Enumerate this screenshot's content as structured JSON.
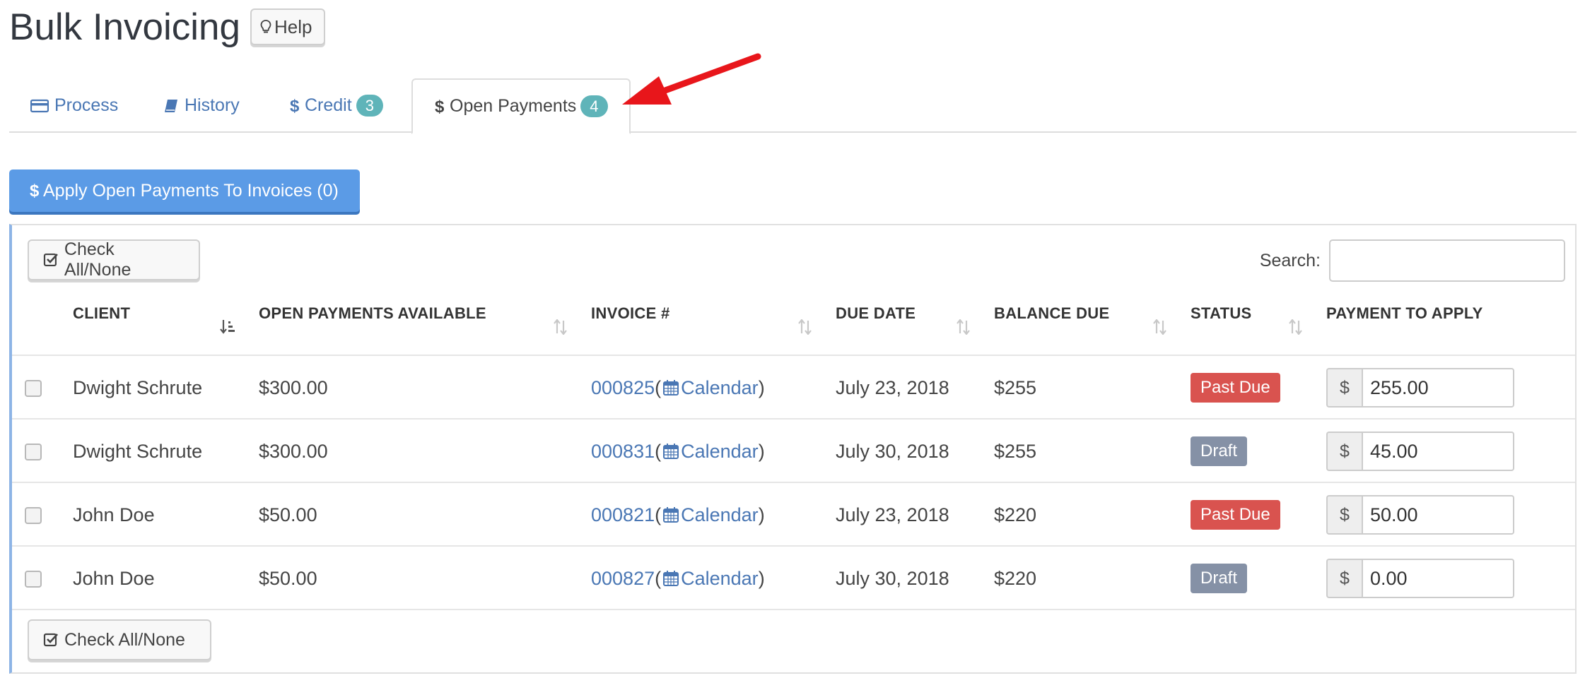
{
  "page": {
    "title": "Bulk Invoicing",
    "help_label": "Help"
  },
  "tabs": [
    {
      "label": "Process",
      "icon": "credit-card-icon",
      "badge": null
    },
    {
      "label": "History",
      "icon": "book-icon",
      "badge": null
    },
    {
      "label": "Credit",
      "icon": "dollar-icon",
      "badge": "3"
    },
    {
      "label": "Open Payments",
      "icon": "dollar-icon",
      "badge": "4",
      "active": true
    }
  ],
  "apply_button": {
    "label": "Apply Open Payments To Invoices (0)"
  },
  "table": {
    "check_all_label": "Check All/None",
    "search_label": "Search:",
    "search_value": "",
    "columns": [
      "CLIENT",
      "OPEN PAYMENTS AVAILABLE",
      "INVOICE #",
      "DUE DATE",
      "BALANCE DUE",
      "STATUS",
      "PAYMENT TO APPLY"
    ],
    "rows": [
      {
        "client": "Dwight Schrute",
        "open_payments": "$300.00",
        "invoice": "000825",
        "calendar": "Calendar",
        "due_date": "July 23, 2018",
        "balance": "$255",
        "status": "Past Due",
        "currency": "$",
        "payment": "255.00"
      },
      {
        "client": "Dwight Schrute",
        "open_payments": "$300.00",
        "invoice": "000831",
        "calendar": "Calendar",
        "due_date": "July 30, 2018",
        "balance": "$255",
        "status": "Draft",
        "currency": "$",
        "payment": "45.00"
      },
      {
        "client": "John Doe",
        "open_payments": "$50.00",
        "invoice": "000821",
        "calendar": "Calendar",
        "due_date": "July 23, 2018",
        "balance": "$220",
        "status": "Past Due",
        "currency": "$",
        "payment": "50.00"
      },
      {
        "client": "John Doe",
        "open_payments": "$50.00",
        "invoice": "000827",
        "calendar": "Calendar",
        "due_date": "July 30, 2018",
        "balance": "$220",
        "status": "Draft",
        "currency": "$",
        "payment": "0.00"
      }
    ]
  },
  "colors": {
    "link": "#4a77b4",
    "primary_button": "#5b9be6",
    "badge": "#5fb4b9",
    "status_past_due": "#d9534f",
    "status_draft": "#8591a6",
    "annotation_arrow": "#e8161b"
  }
}
